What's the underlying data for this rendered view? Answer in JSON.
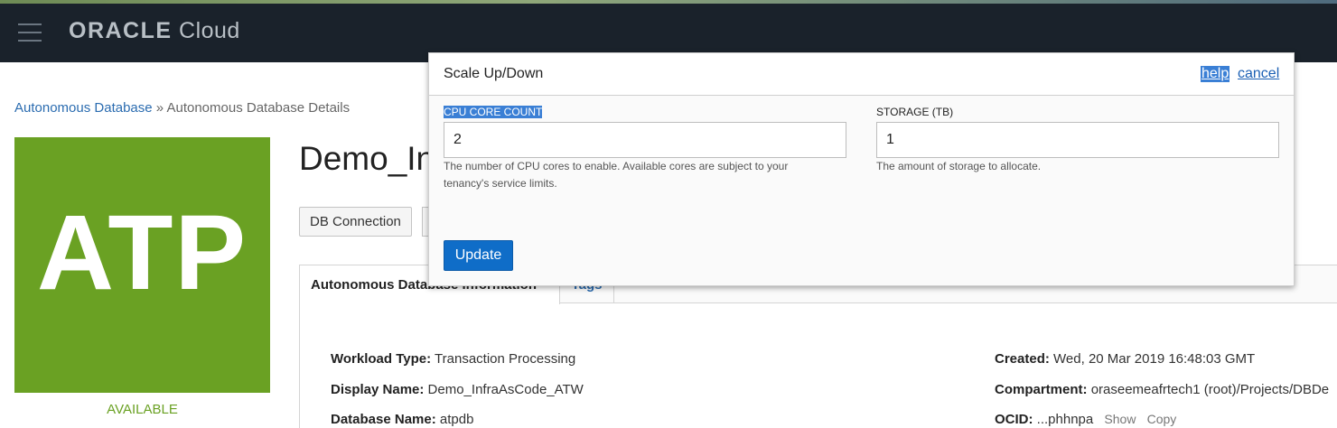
{
  "header": {
    "brand_oracle": "ORACLE",
    "brand_cloud": "Cloud"
  },
  "breadcrumb": {
    "parent": "Autonomous Database",
    "separator": "»",
    "current": "Autonomous Database Details"
  },
  "database": {
    "tile_text": "ATP",
    "status": "AVAILABLE",
    "title": "Demo_InfraAsCode_ATW",
    "db_connection_button": "DB Connection"
  },
  "tabs": [
    {
      "label": "Autonomous Database Information"
    },
    {
      "label": "Tags"
    }
  ],
  "info": {
    "workload_type_label": "Workload Type:",
    "workload_type_value": "Transaction Processing",
    "display_name_label": "Display Name:",
    "display_name_value": "Demo_InfraAsCode_ATW",
    "database_name_label": "Database Name:",
    "database_name_value": "atpdb",
    "created_label": "Created:",
    "created_value": "Wed, 20 Mar 2019 16:48:03 GMT",
    "compartment_label": "Compartment:",
    "compartment_value": "oraseemeafrtech1 (root)/Projects/DBDe",
    "ocid_label": "OCID:",
    "ocid_value": "...phhnpa",
    "ocid_show": "Show",
    "ocid_copy": "Copy"
  },
  "modal": {
    "title": "Scale Up/Down",
    "help_link": "help",
    "cancel_link": "cancel",
    "cpu_label": "CPU CORE COUNT",
    "cpu_value": "2",
    "cpu_help": "The number of CPU cores to enable. Available cores are subject to your tenancy's service limits.",
    "storage_label": "STORAGE (TB)",
    "storage_value": "1",
    "storage_help": "The amount of storage to allocate.",
    "update_button": "Update"
  },
  "colors": {
    "header_bg": "#1a222b",
    "atp_green": "#6aa123",
    "primary_button": "#0f6dc8",
    "link_blue": "#2b6cb0"
  }
}
